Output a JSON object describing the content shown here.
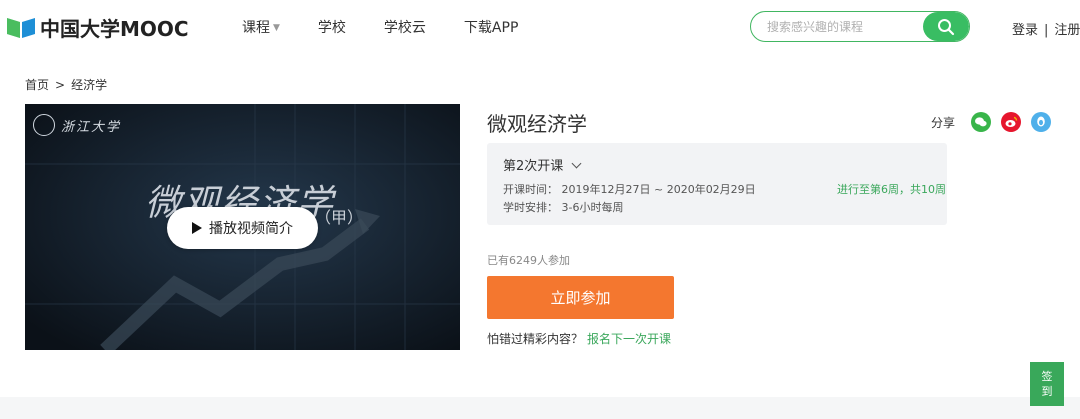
{
  "header": {
    "logo_text": "中国大学MOOC",
    "nav": [
      {
        "label": "课程",
        "has_dropdown": true
      },
      {
        "label": "学校",
        "has_dropdown": false
      },
      {
        "label": "学校云",
        "has_dropdown": false
      },
      {
        "label": "下载APP",
        "has_dropdown": false
      }
    ],
    "search": {
      "placeholder": "搜索感兴趣的课程",
      "icon": "search-icon"
    },
    "auth": {
      "login": "登录",
      "separator": "|",
      "register": "注册"
    }
  },
  "breadcrumb": [
    "首页",
    ">",
    "经济学"
  ],
  "video": {
    "university": "浙江大学",
    "title_text": "微观经济学",
    "subtitle_text": "（甲）",
    "play_label": "播放视频简介"
  },
  "course": {
    "title": "微观经济学",
    "share": {
      "label": "分享",
      "icons": [
        "wechat-icon",
        "weibo-icon",
        "qq-icon"
      ],
      "colors": {
        "wechat": "#39b54a",
        "weibo": "#e6162d",
        "qq": "#4fb0ea"
      }
    },
    "term": {
      "name": "第2次开课",
      "time": "开课时间： 2019年12月27日 ~ 2020年02月29日",
      "hours": "学时安排： 3-6小时每周",
      "progress": "进行至第6周，共10周"
    },
    "enrolled": "已有6249人参加",
    "join_label": "立即参加",
    "missed_text": "怕错过精彩内容？",
    "next_term_link": "报名下一次开课"
  },
  "sign_in": {
    "line1": "签",
    "line2": "到"
  },
  "colors": {
    "accent_green": "#39bd63",
    "cta_orange": "#f4772f"
  }
}
